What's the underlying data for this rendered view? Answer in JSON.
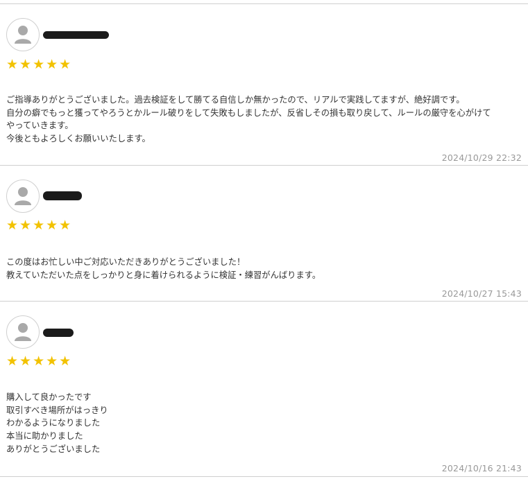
{
  "colors": {
    "star": "#f2c200",
    "divider": "#cfcfcf",
    "date_text": "#999999",
    "body_text": "#333333",
    "redaction": "#1b1b1b"
  },
  "reviews": [
    {
      "stars": "★★★★★",
      "rating": 5,
      "lines": [
        "ご指導ありがとうございました。過去検証をして勝てる自信しか無かったので、リアルで実践してますが、絶好調です。",
        "自分の癖でもっと獲ってやろうとかルール破りをして失敗もしましたが、反省しその損も取り戻して、ルールの厳守を心がけて",
        "やっていきます。",
        "今後ともよろしくお願いいたします。"
      ],
      "date": "2024/10/29 22:32"
    },
    {
      "stars": "★★★★★",
      "rating": 5,
      "lines": [
        "この度はお忙しい中ご対応いただきありがとうございました！",
        "教えていただいた点をしっかりと身に着けられるように検証・練習がんばります。"
      ],
      "date": "2024/10/27 15:43"
    },
    {
      "stars": "★★★★★",
      "rating": 5,
      "lines": [
        "購入して良かったです",
        "取引すべき場所がはっきり",
        "わかるようになりました",
        "本当に助かりました",
        "ありがとうございました"
      ],
      "date": "2024/10/16 21:43"
    }
  ]
}
